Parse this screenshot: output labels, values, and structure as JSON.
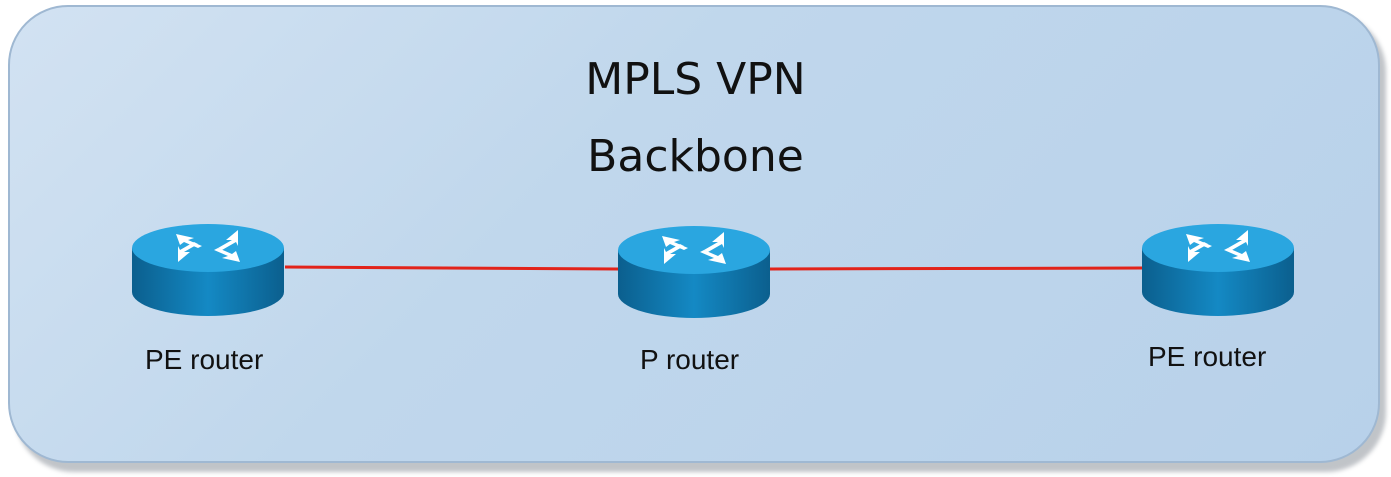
{
  "diagram": {
    "title_line1": "MPLS VPN",
    "title_line2": "Backbone",
    "colors": {
      "backbone_fill": "#c0d7ec",
      "link": "#e2231a",
      "router_top": "#2aa6e0",
      "router_side": "#0a6fa3"
    },
    "routers": [
      {
        "id": "pe-left",
        "label": "PE router",
        "icon": "router-icon"
      },
      {
        "id": "p-center",
        "label": "P router",
        "icon": "router-icon"
      },
      {
        "id": "pe-right",
        "label": "PE router",
        "icon": "router-icon"
      }
    ],
    "links": [
      {
        "from": "pe-left",
        "to": "p-center"
      },
      {
        "from": "p-center",
        "to": "pe-right"
      }
    ]
  }
}
